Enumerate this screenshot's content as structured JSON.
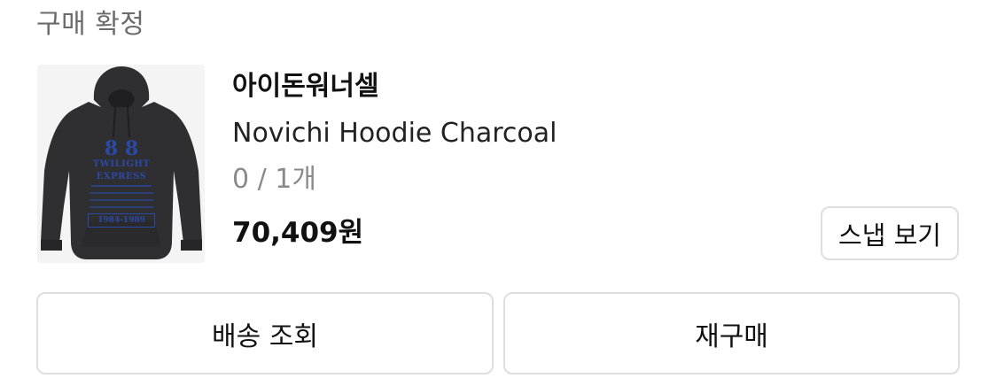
{
  "order": {
    "status_title": "구매 확정"
  },
  "product": {
    "brand": "아이돈워너셀",
    "name": "Novichi Hoodie Charcoal",
    "option": "0 / 1개",
    "price": "70,409원",
    "image": {
      "icon": "hoodie-image",
      "print_lines": [
        "8 8",
        "TWILIGHT",
        "EXPRESS",
        "1984-1989"
      ],
      "garment_color": "#2f2f31",
      "print_color": "#2b49a6"
    }
  },
  "actions": {
    "snap_label": "스냅 보기",
    "delivery_label": "배송 조회",
    "rebuy_label": "재구매"
  }
}
